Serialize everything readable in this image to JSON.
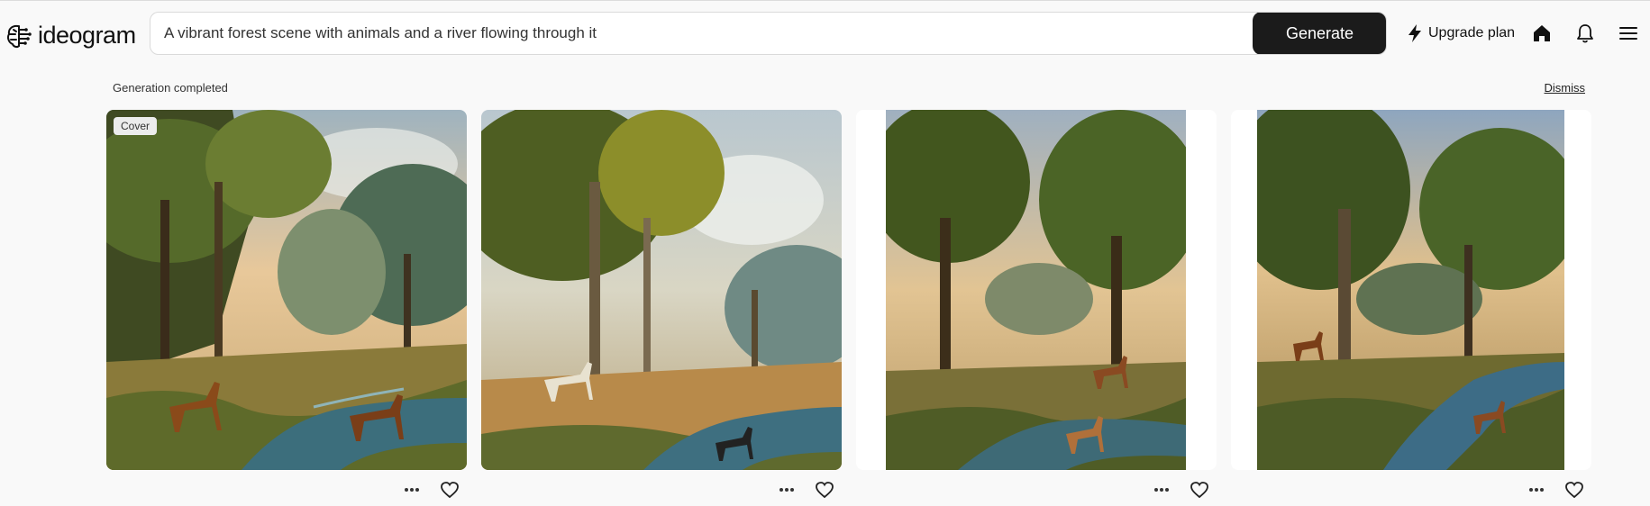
{
  "brand": {
    "name": "ideogram"
  },
  "search": {
    "value": "A vibrant forest scene with animals and a river flowing through it",
    "generate_label": "Generate"
  },
  "header": {
    "upgrade_label": "Upgrade plan",
    "icons": [
      "bolt-icon",
      "home-icon",
      "bell-icon",
      "menu-icon"
    ]
  },
  "status": {
    "text": "Generation completed",
    "dismiss_label": "Dismiss"
  },
  "gallery": {
    "cover_label": "Cover",
    "images": [
      {
        "subject": "forest river scene with deer",
        "cover": true
      },
      {
        "subject": "forest river scene with animals",
        "cover": false
      },
      {
        "subject": "forest river scene with deer",
        "cover": false
      },
      {
        "subject": "forest river scene with deer",
        "cover": false
      }
    ]
  }
}
